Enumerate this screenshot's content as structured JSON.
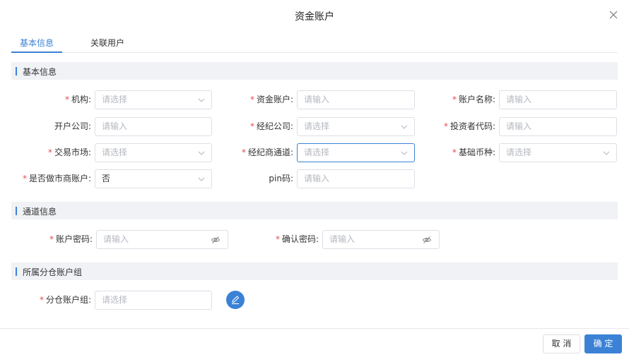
{
  "dialog": {
    "title": "资金账户"
  },
  "tabs": [
    {
      "label": "基本信息"
    },
    {
      "label": "关联用户"
    }
  ],
  "sections": [
    {
      "title": "基本信息"
    },
    {
      "title": "通道信息"
    },
    {
      "title": "所属分仓账户组"
    }
  ],
  "required_mark": "*",
  "basic_fields": {
    "institution": {
      "label": "机构:",
      "placeholder": "请选择"
    },
    "fund_account": {
      "label": "资金账户:",
      "placeholder": "请输入"
    },
    "account_name": {
      "label": "账户名称:",
      "placeholder": "请输入"
    },
    "opening_company": {
      "label": "开户公司:",
      "placeholder": "请输入"
    },
    "broker_company": {
      "label": "经纪公司:",
      "placeholder": "请选择"
    },
    "investor_code": {
      "label": "投资者代码:",
      "placeholder": "请输入"
    },
    "exchange": {
      "label": "交易市场:",
      "placeholder": "请选择"
    },
    "broker_channel": {
      "label": "经纪商通道:",
      "placeholder": "请选择"
    },
    "base_currency": {
      "label": "基础币种:",
      "placeholder": "请选择"
    },
    "market_maker": {
      "label": "是否做市商账户:",
      "value": "否"
    },
    "pin_code": {
      "label": "pin码:",
      "placeholder": "请输入"
    }
  },
  "channel_fields": {
    "account_password": {
      "label": "账户密码:",
      "placeholder": "请输入"
    },
    "confirm_password": {
      "label": "确认密码:",
      "placeholder": "请输入"
    }
  },
  "group_fields": {
    "sub_account_group": {
      "label": "分仓账户组:",
      "placeholder": "请选择"
    }
  },
  "footer": {
    "cancel": "取 消",
    "confirm": "确 定"
  },
  "colors": {
    "primary": "#3b82d6",
    "required": "#e54b4b",
    "section_bg": "#f0f2f5"
  }
}
